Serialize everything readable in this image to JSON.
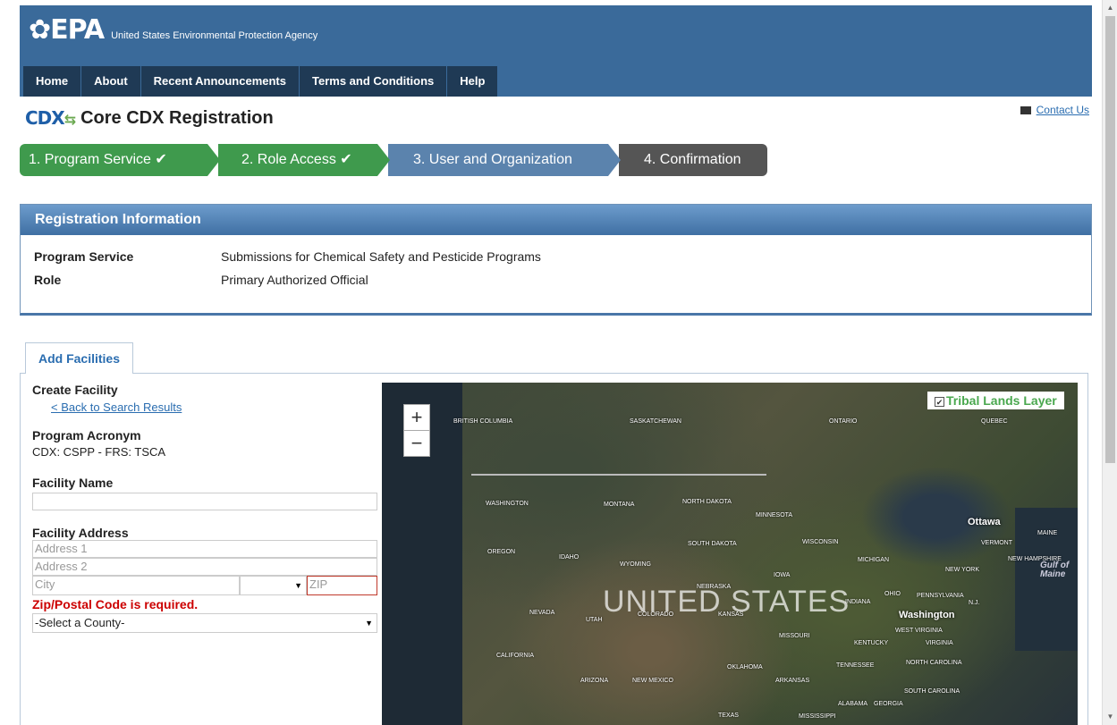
{
  "header": {
    "logo_text": "EPA",
    "agency": "United States Environmental Protection Agency",
    "nav": [
      "Home",
      "About",
      "Recent Announcements",
      "Terms and Conditions",
      "Help"
    ]
  },
  "page": {
    "cdx_logo": "CDX",
    "title": "Core CDX Registration",
    "contact": "Contact Us"
  },
  "steps": [
    {
      "label": "1. Program Service ✔"
    },
    {
      "label": "2. Role Access ✔"
    },
    {
      "label": "3. User and Organization"
    },
    {
      "label": "4. Confirmation"
    }
  ],
  "registration": {
    "heading": "Registration Information",
    "rows": [
      {
        "key": "Program Service",
        "value": "Submissions for Chemical Safety and Pesticide Programs"
      },
      {
        "key": "Role",
        "value": "Primary Authorized Official"
      }
    ]
  },
  "tab": {
    "label": "Add Facilities"
  },
  "form": {
    "create_title": "Create Facility",
    "back_link": "< Back to Search Results",
    "acronym_label": "Program Acronym",
    "acronym_value": "CDX: CSPP - FRS: TSCA",
    "name_label": "Facility Name",
    "name_value": "",
    "address_label": "Facility Address",
    "address1_placeholder": "Address 1",
    "address2_placeholder": "Address 2",
    "city_placeholder": "City",
    "state_value": "",
    "zip_placeholder": "ZIP",
    "zip_error": "Zip/Postal Code is required.",
    "county_value": "-Select a County-"
  },
  "map": {
    "zoom_in": "+",
    "zoom_out": "−",
    "layer_label": "Tribal Lands Layer",
    "layer_checked": true,
    "country": "UNITED STATES",
    "cities": [
      "Ottawa",
      "Washington"
    ],
    "gulf_label_1": "Gulf of",
    "gulf_label_2": "Maine",
    "regions": [
      "BRITISH COLUMBIA",
      "SASKATCHEWAN",
      "ONTARIO",
      "QUEBEC",
      "WASHINGTON",
      "MONTANA",
      "NORTH DAKOTA",
      "MINNESOTA",
      "OREGON",
      "IDAHO",
      "SOUTH DAKOTA",
      "WISCONSIN",
      "WYOMING",
      "MICHIGAN",
      "VERMONT",
      "MAINE",
      "NEBRASKA",
      "IOWA",
      "NEW YORK",
      "NEW HAMPSHIRE",
      "NEVADA",
      "UTAH",
      "COLORADO",
      "KANSAS",
      "INDIANA",
      "OHIO",
      "PENNSYLVANIA",
      "N.J.",
      "CALIFORNIA",
      "MISSOURI",
      "KENTUCKY",
      "WEST VIRGINIA",
      "VIRGINIA",
      "OKLAHOMA",
      "TENNESSEE",
      "NORTH CAROLINA",
      "ARIZONA",
      "NEW MEXICO",
      "ARKANSAS",
      "SOUTH CAROLINA",
      "ALABAMA",
      "GEORGIA",
      "TEXAS",
      "MISSISSIPPI"
    ]
  }
}
